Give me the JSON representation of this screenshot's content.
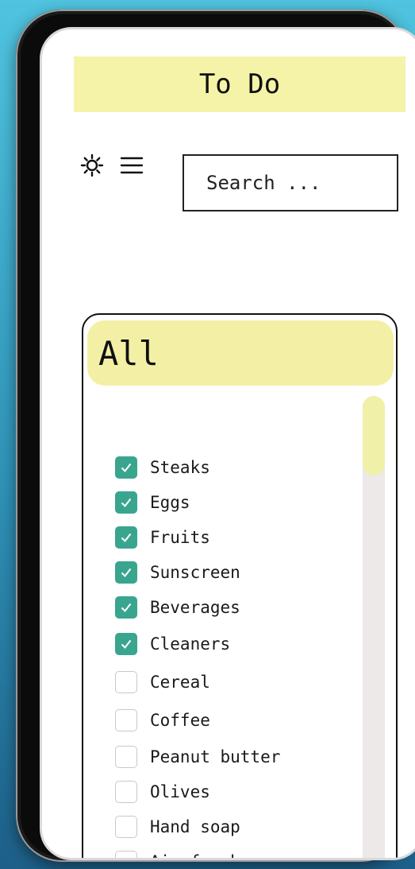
{
  "header": {
    "title": "To Do"
  },
  "toolbar": {
    "theme_icon": "sun-icon",
    "menu_icon": "hamburger-menu-icon",
    "search_placeholder": "Search ..."
  },
  "list": {
    "title": "All",
    "items": [
      {
        "label": "Steaks",
        "checked": true
      },
      {
        "label": "Eggs",
        "checked": true
      },
      {
        "label": "Fruits",
        "checked": true
      },
      {
        "label": "Sunscreen",
        "checked": true
      },
      {
        "label": "Beverages",
        "checked": true
      },
      {
        "label": "Cleaners",
        "checked": true
      },
      {
        "label": "Cereal",
        "checked": false
      },
      {
        "label": "Coffee",
        "checked": false
      },
      {
        "label": "Peanut butter",
        "checked": false
      },
      {
        "label": "Olives",
        "checked": false
      },
      {
        "label": "Hand soap",
        "checked": false
      },
      {
        "label": "Air freshener",
        "checked": false
      }
    ]
  },
  "colors": {
    "accent_yellow": "#f5f3a8",
    "checkbox_green": "#3aa58f",
    "scroll_track": "#ece9e8"
  }
}
